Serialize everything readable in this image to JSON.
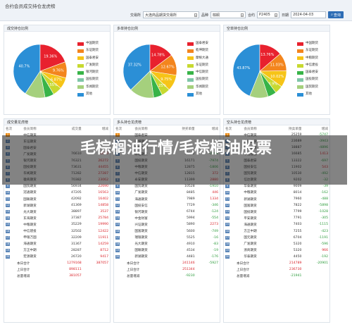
{
  "toolbar": {
    "title": "合约会员成交持仓龙虎榜",
    "exchange_label": "交易所",
    "exchange_value": "大连商品期货交易所",
    "variety_label": "品种",
    "variety_value": "棕榈",
    "contract_label": "合约",
    "contract_value": "P2405",
    "date_label": "日期",
    "date_value": "2024-04-03",
    "query_label": "查询"
  },
  "pies": [
    {
      "title": "成交持仓比例",
      "segments": [
        {
          "value": 40.7,
          "color": "#2b8fd6"
        },
        {
          "value": 19.36,
          "color": "#e8212e"
        },
        {
          "value": 9.76,
          "color": "#f3851d"
        },
        {
          "value": 6.87,
          "color": "#f6c417"
        },
        {
          "value": 5.55,
          "color": "#c7d930"
        },
        {
          "value": 5.5,
          "color": "#38b448"
        },
        {
          "value": 12.26,
          "color": "#a5d07d"
        }
      ],
      "labels": [
        "40.7%",
        "19.36%",
        "9.76%",
        "6.87%",
        "5.55%"
      ],
      "legend": [
        "中国期货",
        "东证期货",
        "国泰君安",
        "广发期货",
        "银河期货",
        "国投期货",
        "华闻期货",
        "其他"
      ]
    },
    {
      "title": "多单持仓比例",
      "segments": [
        {
          "value": 37.32,
          "color": "#2b8fd6"
        },
        {
          "value": 14.78,
          "color": "#e8212e"
        },
        {
          "value": 12.67,
          "color": "#f3851d"
        },
        {
          "value": 9.75,
          "color": "#f6c417"
        },
        {
          "value": 5.25,
          "color": "#c7d930"
        },
        {
          "value": 5.3,
          "color": "#38b448"
        },
        {
          "value": 14.93,
          "color": "#a5d07d"
        }
      ],
      "labels": [
        "37.32%",
        "14.78%",
        "12.67%",
        "9.75%",
        "5.25%"
      ],
      "legend": [
        "国泰君安",
        "乾坤期货",
        "摩根大通",
        "东证期货",
        "中信期货",
        "国投期货",
        "华闻期货",
        "其他"
      ]
    },
    {
      "title": "空单持仓比例",
      "segments": [
        {
          "value": 43.87,
          "color": "#2b8fd6"
        },
        {
          "value": 13.76,
          "color": "#e8212e"
        },
        {
          "value": 11.03,
          "color": "#f3851d"
        },
        {
          "value": 10.02,
          "color": "#f6c417"
        },
        {
          "value": 4.9,
          "color": "#c7d930"
        },
        {
          "value": 5.2,
          "color": "#38b448"
        },
        {
          "value": 11.22,
          "color": "#a5d07d"
        }
      ],
      "labels": [
        "43.87%",
        "13.76%",
        "11.03%",
        "10.02%",
        "4.9%"
      ],
      "legend": [
        "中国期货",
        "东证期货",
        "中粮期货",
        "中信建投",
        "国泰君安",
        "国投期货",
        "国贸期货",
        "其他"
      ]
    }
  ],
  "vol_table": {
    "title": "成交量龙虎榜",
    "headers": [
      "名次",
      "会员简称",
      "成交量",
      "增减"
    ],
    "rows": [
      [
        "1",
        "中信期货",
        "",
        "",
        "orange"
      ],
      [
        "2",
        "东证期货",
        "",
        "",
        ""
      ],
      [
        "3",
        "国泰君安",
        "",
        "",
        ""
      ],
      [
        "4",
        "广发期货",
        "76610",
        "15070",
        ""
      ],
      [
        "5",
        "银河期货",
        "76321",
        "26272",
        ""
      ],
      [
        "6",
        "国投期货",
        "73631",
        "44455",
        ""
      ],
      [
        "7",
        "华闻期货",
        "71282",
        "27287",
        ""
      ],
      [
        "8",
        "徽商期货",
        "70382",
        "23062",
        ""
      ],
      [
        "9",
        "国贸期货",
        "56934",
        "22690",
        ""
      ],
      [
        "10",
        "冠通期货",
        "47205",
        "16563",
        ""
      ],
      [
        "11",
        "国联期货",
        "42092",
        "16402",
        ""
      ],
      [
        "12",
        "新湖期货",
        "41369",
        "14858",
        ""
      ],
      [
        "13",
        "光大期货",
        "38897",
        "3537",
        ""
      ],
      [
        "14",
        "东海期货",
        "37387",
        "25784",
        ""
      ],
      [
        "15",
        "中粮期货",
        "35229",
        "19990",
        ""
      ],
      [
        "16",
        "中信建投",
        "32502",
        "12422",
        ""
      ],
      [
        "17",
        "申银万国",
        "32209",
        "11911",
        ""
      ],
      [
        "18",
        "海通期货",
        "31367",
        "14259",
        ""
      ],
      [
        "19",
        "方正中期",
        "28287",
        "8712",
        ""
      ],
      [
        "20",
        "宏源期货",
        "26720",
        "9417",
        ""
      ]
    ],
    "sum": [
      [
        "本日合计",
        "1279168",
        "387057"
      ],
      [
        "上日合计",
        "898111",
        ""
      ],
      [
        "总量增减",
        "381057",
        ""
      ]
    ]
  },
  "long_table": {
    "title": "多头持仓龙虎榜",
    "headers": [
      "名次",
      "会员简称",
      "持买单量",
      "增减"
    ],
    "rows": [
      [
        "1",
        "国泰君安",
        "",
        "",
        "orange"
      ],
      [
        "2",
        "乾坤期货",
        "",
        "",
        ""
      ],
      [
        "3",
        "摩根大通",
        "",
        "",
        ""
      ],
      [
        "4",
        "东证期货",
        "18942",
        "-2306",
        ""
      ],
      [
        "5",
        "国投期货",
        "16171",
        "-7974",
        ""
      ],
      [
        "6",
        "中粮期货",
        "12875",
        "-1806",
        ""
      ],
      [
        "7",
        "中信期货",
        "12815",
        "372",
        ""
      ],
      [
        "8",
        "永安期货",
        "11399",
        "2880",
        ""
      ],
      [
        "9",
        "国贸期货",
        "10528",
        "-1910",
        ""
      ],
      [
        "10",
        "广发期货",
        "8485",
        "446",
        ""
      ],
      [
        "11",
        "海通期货",
        "7989",
        "1334",
        ""
      ],
      [
        "12",
        "国投安信",
        "7729",
        "-346",
        ""
      ],
      [
        "13",
        "银河期货",
        "6744",
        "-124",
        ""
      ],
      [
        "14",
        "中金财富",
        "5994",
        "-554",
        ""
      ],
      [
        "15",
        "兴证期货",
        "5890",
        "2273",
        ""
      ],
      [
        "16",
        "国富期货",
        "5600",
        "-749",
        ""
      ],
      [
        "17",
        "瑞银期货",
        "5525",
        "-16",
        ""
      ],
      [
        "18",
        "光大期货",
        "4910",
        "-83",
        ""
      ],
      [
        "19",
        "国联期货",
        "4534",
        "-19",
        ""
      ],
      [
        "20",
        "新湖期货",
        "4481",
        "-176",
        ""
      ]
    ],
    "sum": [
      [
        "本日合计",
        "241146",
        "-5927"
      ],
      [
        "上日合计",
        "251344",
        ""
      ],
      [
        "总量增减",
        "-9230",
        ""
      ]
    ]
  },
  "short_table": {
    "title": "空头持仓龙虎榜",
    "headers": [
      "名次",
      "会员简称",
      "持卖单量",
      "增减"
    ],
    "rows": [
      [
        "1",
        "中信期货",
        "25259",
        "-5747",
        "orange"
      ],
      [
        "2",
        "东证期货",
        "23689",
        "-3943",
        ""
      ],
      [
        "3",
        "中粮期货",
        "18887",
        "-4896",
        ""
      ],
      [
        "4",
        "中信建投",
        "16685",
        "1413",
        ""
      ],
      [
        "5",
        "国泰君安",
        "13322",
        "-697",
        ""
      ],
      [
        "6",
        "国投安信",
        "11902",
        "543",
        ""
      ],
      [
        "7",
        "国贸期货",
        "10530",
        "-492",
        ""
      ],
      [
        "8",
        "信达期货",
        "9202",
        "-32",
        ""
      ],
      [
        "9",
        "华泰期货",
        "9009",
        "-39",
        ""
      ],
      [
        "10",
        "中粮期货",
        "8014",
        "-162",
        ""
      ],
      [
        "11",
        "新湖期货",
        "7960",
        "-488",
        ""
      ],
      [
        "12",
        "国富期货",
        "7822",
        "-5898",
        ""
      ],
      [
        "13",
        "国投期货",
        "7799",
        "-1028",
        ""
      ],
      [
        "14",
        "平安期货",
        "7791",
        "-305",
        ""
      ],
      [
        "15",
        "海通期货",
        "7403",
        "-1115",
        ""
      ],
      [
        "16",
        "方正中期",
        "7255",
        "-423",
        ""
      ],
      [
        "17",
        "国元期货",
        "6704",
        "-1191",
        ""
      ],
      [
        "18",
        "广发期货",
        "5320",
        "-596",
        ""
      ],
      [
        "19",
        "浙商期货",
        "5320",
        "966",
        ""
      ],
      [
        "20",
        "华泰期货",
        "4450",
        "-192",
        ""
      ]
    ],
    "sum": [
      [
        "本日合计",
        "214789",
        "-20901"
      ],
      [
        "上日合计",
        "236730",
        ""
      ],
      [
        "总量增减",
        "-21941",
        ""
      ]
    ]
  },
  "overlay_text": "毛棕榈油行情/毛棕榈油股票"
}
